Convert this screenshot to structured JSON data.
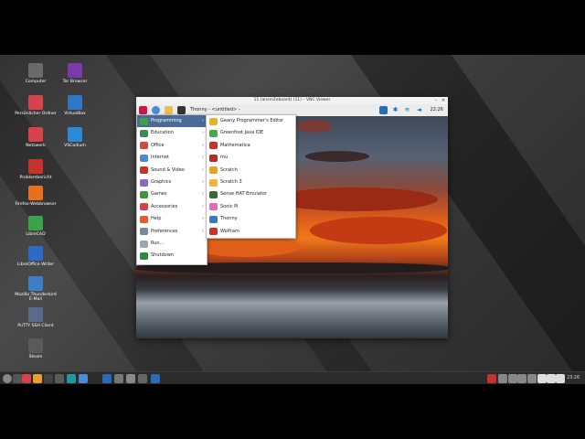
{
  "desktop": {
    "icons": [
      {
        "label": "Computer",
        "icon": "computer-icon",
        "color": "#6a6a6a"
      },
      {
        "label": "Tor Browser",
        "icon": "tor-icon",
        "color": "#7c3aa8"
      },
      {
        "label": "Persönlicher Ordner",
        "icon": "home-folder-icon",
        "color": "#d8424a"
      },
      {
        "label": "VirtualBox",
        "icon": "virtualbox-icon",
        "color": "#2f78c4"
      },
      {
        "label": "Netzwerk",
        "icon": "network-icon",
        "color": "#d8424a"
      },
      {
        "label": "VSCodium",
        "icon": "vscodium-icon",
        "color": "#2b8ad6"
      },
      {
        "label": "Problembericht",
        "icon": "problem-report-icon",
        "color": "#c8322a"
      },
      {
        "label": "Firefox-Webbrowser",
        "icon": "firefox-icon",
        "color": "#e8701a"
      },
      {
        "label": "LibreCAD",
        "icon": "librecad-icon",
        "color": "#3aa34a"
      },
      {
        "label": "LibreOffice Writer",
        "icon": "writer-icon",
        "color": "#2a6ac8"
      },
      {
        "label": "Mozilla Thunderbird E-Mail",
        "icon": "thunderbird-icon",
        "color": "#3c7ec8"
      },
      {
        "label": "PuTTY SSH Client",
        "icon": "putty-icon",
        "color": "#5a6a8a"
      },
      {
        "label": "Steam",
        "icon": "steam-icon",
        "color": "#5a5a5a"
      }
    ]
  },
  "vnc_window": {
    "title": "11 (ansm2eboard) (11) – VNC Viewer",
    "min_glyph": "–",
    "close_glyph": "✕"
  },
  "pi_panel": {
    "task_title": "Thonny - <untitled> -",
    "clock": "22:26"
  },
  "main_menu": {
    "items": [
      {
        "label": "Programming",
        "icon": "programming-icon",
        "color": "#3aa34a",
        "submenu": true,
        "highlighted": true
      },
      {
        "label": "Education",
        "icon": "education-icon",
        "color": "#3a8a5a",
        "submenu": true
      },
      {
        "label": "Office",
        "icon": "office-icon",
        "color": "#d24a3a",
        "submenu": true
      },
      {
        "label": "Internet",
        "icon": "internet-icon",
        "color": "#4a8ad8",
        "submenu": true
      },
      {
        "label": "Sound & Video",
        "icon": "sound-video-icon",
        "color": "#c8342a",
        "submenu": true
      },
      {
        "label": "Graphics",
        "icon": "graphics-icon",
        "color": "#8a6ac8",
        "submenu": true
      },
      {
        "label": "Games",
        "icon": "games-icon",
        "color": "#3a9a3a",
        "submenu": true
      },
      {
        "label": "Accessories",
        "icon": "accessories-icon",
        "color": "#d8424a",
        "submenu": true
      },
      {
        "label": "Help",
        "icon": "help-icon",
        "color": "#e85a2a",
        "submenu": true
      },
      {
        "label": "Preferences",
        "icon": "preferences-icon",
        "color": "#7a8a9a",
        "submenu": true
      },
      {
        "label": "Run...",
        "icon": "run-icon",
        "color": "#9aa6b2",
        "submenu": false
      },
      {
        "label": "Shutdown",
        "icon": "shutdown-icon",
        "color": "#2a8a3a",
        "submenu": false
      }
    ],
    "arrow_glyph": "›"
  },
  "programming_menu": {
    "items": [
      {
        "label": "Geany Programmer's Editor",
        "icon": "geany-icon",
        "color": "#e8b02a"
      },
      {
        "label": "Greenfoot Java IDE",
        "icon": "greenfoot-icon",
        "color": "#4aa84a"
      },
      {
        "label": "Mathematica",
        "icon": "mathematica-icon",
        "color": "#c8322a"
      },
      {
        "label": "mu",
        "icon": "mu-icon",
        "color": "#b82a2a"
      },
      {
        "label": "Scratch",
        "icon": "scratch-icon",
        "color": "#e8a02a"
      },
      {
        "label": "Scratch 3",
        "icon": "scratch3-icon",
        "color": "#f0b43a"
      },
      {
        "label": "Sense HAT Emulator",
        "icon": "sense-hat-icon",
        "color": "#3a6a3a"
      },
      {
        "label": "Sonic Pi",
        "icon": "sonic-pi-icon",
        "color": "#e86ab0"
      },
      {
        "label": "Thonny",
        "icon": "thonny-icon",
        "color": "#3a78c8"
      },
      {
        "label": "Wolfram",
        "icon": "wolfram-icon",
        "color": "#c8322a"
      }
    ]
  },
  "host_taskbar": {
    "clock": "23:26"
  }
}
